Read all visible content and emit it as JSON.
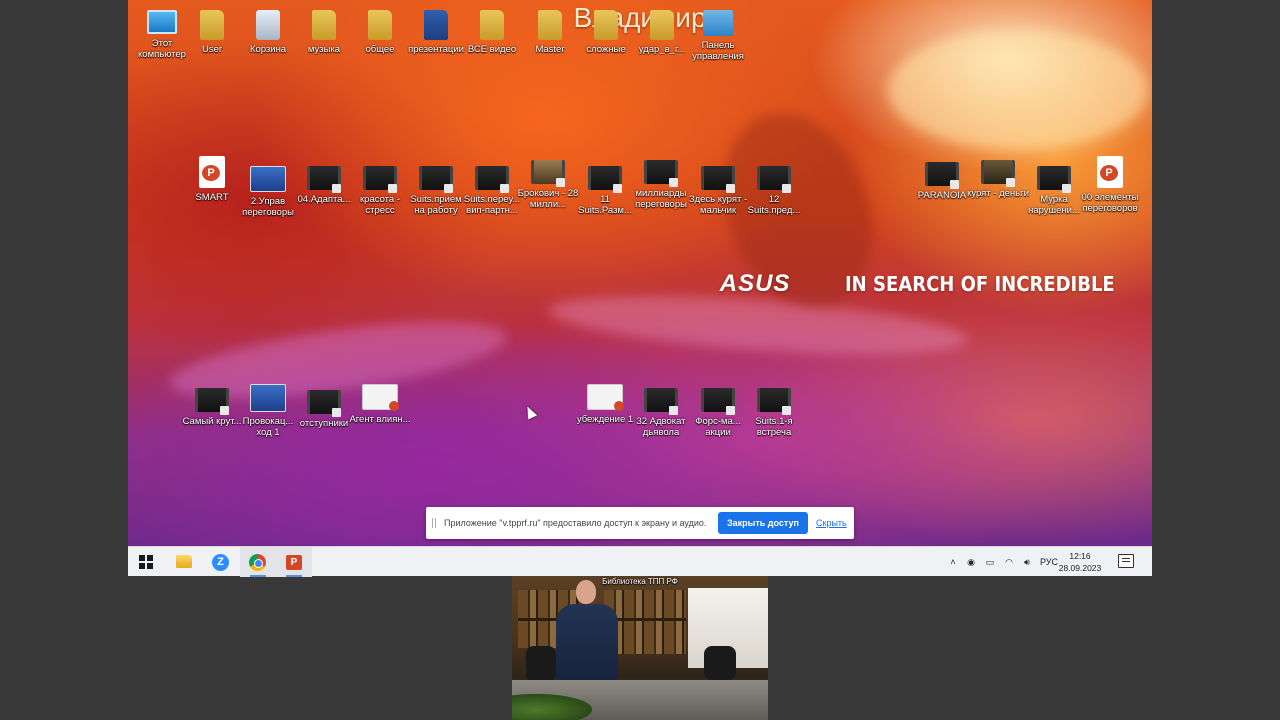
{
  "presenter": {
    "name": "Владимир"
  },
  "desktop": {
    "row1": [
      {
        "label": "Этот компьютер",
        "icon": "computer-icon"
      },
      {
        "label": "User",
        "icon": "user-folder-icon"
      },
      {
        "label": "Корзина",
        "icon": "recycle-bin-icon"
      },
      {
        "label": "музыка",
        "icon": "folder-icon"
      },
      {
        "label": "общее",
        "icon": "folder-icon"
      },
      {
        "label": "презентации",
        "icon": "folder-icon"
      },
      {
        "label": "ВСЕ видео",
        "icon": "folder-icon"
      },
      {
        "label": "Master",
        "icon": "folder-icon"
      },
      {
        "label": "сложные",
        "icon": "folder-icon"
      },
      {
        "label": "удар_в_г...",
        "icon": "folder-icon"
      },
      {
        "label": "Панель управления",
        "icon": "control-panel-icon"
      }
    ],
    "row2": [
      {
        "label": "SMART",
        "icon": "powerpoint-file-icon"
      },
      {
        "label": "2.Управ переговоры",
        "icon": "slide-file-icon"
      },
      {
        "label": "04.Адапта...",
        "icon": "video-file-icon"
      },
      {
        "label": "красота - стресс",
        "icon": "video-file-icon"
      },
      {
        "label": "Suits.прием на работу",
        "icon": "video-file-icon"
      },
      {
        "label": "Suits.переу... вип-партн...",
        "icon": "video-file-icon"
      },
      {
        "label": "Брокович - 28 милли...",
        "icon": "video-file-icon"
      },
      {
        "label": "11 Suits.Разм...",
        "icon": "video-file-icon"
      },
      {
        "label": "миллиарды переговоры",
        "icon": "video-file-icon"
      },
      {
        "label": "Здесь курят - мальчик",
        "icon": "video-file-icon"
      },
      {
        "label": "12 Suits.пред...",
        "icon": "video-file-icon"
      }
    ],
    "right_group": [
      {
        "label": "PARANOIA",
        "icon": "video-file-icon"
      },
      {
        "label": "курят - деньги",
        "icon": "video-file-icon"
      },
      {
        "label": "Мурка нарушени...",
        "icon": "video-file-icon"
      },
      {
        "label": "00 элементы переговоров",
        "icon": "powerpoint-file-icon"
      }
    ],
    "row3_left": [
      {
        "label": "Самый крут...",
        "icon": "video-file-icon"
      },
      {
        "label": "Провокац... ход 1",
        "icon": "slide-file-icon"
      },
      {
        "label": "отступники",
        "icon": "video-file-icon"
      },
      {
        "label": "Агент влиян...",
        "icon": "slide-file-icon"
      }
    ],
    "row3_right": [
      {
        "label": "убеждение 1",
        "icon": "slide-file-icon"
      },
      {
        "label": "32 Адвокат дьявола",
        "icon": "video-file-icon"
      },
      {
        "label": "Форс-ма... акции",
        "icon": "video-file-icon"
      },
      {
        "label": "Suits.1-я встреча",
        "icon": "video-file-icon"
      }
    ],
    "brand": {
      "logo": "ASUS",
      "slogan": "IN SEARCH OF INCREDIBLE"
    }
  },
  "share_bar": {
    "message": "Приложение \"v.tpprf.ru\" предоставило доступ к экрану и аудио.",
    "stop_label": "Закрыть доступ",
    "hide_label": "Скрыть"
  },
  "taskbar": {
    "apps": [
      "windows-start-icon",
      "file-explorer-icon",
      "zoom-icon",
      "chrome-icon",
      "powerpoint-icon"
    ],
    "language": "РУС",
    "time": "12:16",
    "date": "28.09.2023"
  },
  "camera": {
    "caption": "Библиотека ТПП РФ"
  },
  "colors": {
    "taskbar_bg": "#f0f1f4",
    "accent": "#1a73e8",
    "powerpoint": "#d24726"
  }
}
